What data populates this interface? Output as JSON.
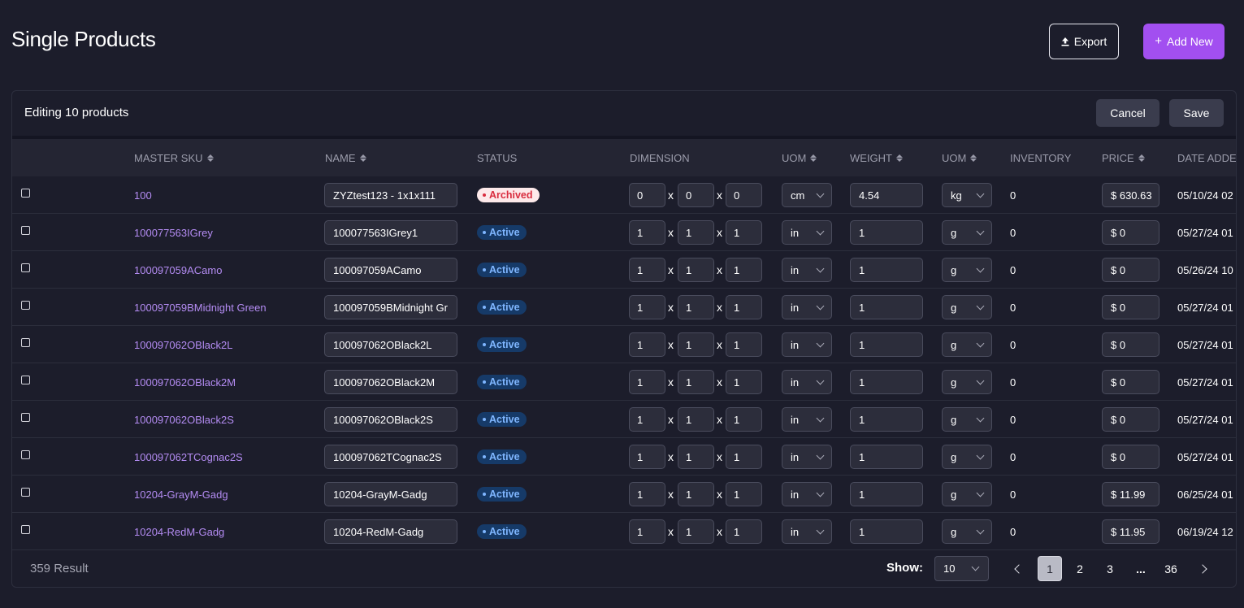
{
  "header": {
    "title": "Single Products",
    "export_label": "Export",
    "add_label": "Add New"
  },
  "edit_bar": {
    "text": "Editing 10 products",
    "cancel_label": "Cancel",
    "save_label": "Save"
  },
  "columns": {
    "master_sku": "MASTER SKU",
    "name": "NAME",
    "status": "STATUS",
    "dimension": "DIMENSION",
    "uom_dim": "UOM",
    "weight": "WEIGHT",
    "uom_weight": "UOM",
    "inventory": "INVENTORY",
    "price": "PRICE",
    "date_added": "DATE ADDED"
  },
  "dimension_separator": "x",
  "rows": [
    {
      "sku": "100",
      "name": "ZYZtest123 - 1x1x111",
      "status": "Archived",
      "d1": "0",
      "d2": "0",
      "d3": "0",
      "uom": "cm",
      "weight": "4.54",
      "wuom": "kg",
      "inventory": "0",
      "price": "$ 630.63",
      "date": "05/10/24 02"
    },
    {
      "sku": "100077563IGrey",
      "name": "100077563IGrey1",
      "status": "Active",
      "d1": "1",
      "d2": "1",
      "d3": "1",
      "uom": "in",
      "weight": "1",
      "wuom": "g",
      "inventory": "0",
      "price": "$ 0",
      "date": "05/27/24 01"
    },
    {
      "sku": "100097059ACamo",
      "name": "100097059ACamo",
      "status": "Active",
      "d1": "1",
      "d2": "1",
      "d3": "1",
      "uom": "in",
      "weight": "1",
      "wuom": "g",
      "inventory": "0",
      "price": "$ 0",
      "date": "05/26/24 10"
    },
    {
      "sku": "100097059BMidnight Green",
      "name": "100097059BMidnight Gr",
      "status": "Active",
      "d1": "1",
      "d2": "1",
      "d3": "1",
      "uom": "in",
      "weight": "1",
      "wuom": "g",
      "inventory": "0",
      "price": "$ 0",
      "date": "05/27/24 01"
    },
    {
      "sku": "100097062OBlack2L",
      "name": "100097062OBlack2L",
      "status": "Active",
      "d1": "1",
      "d2": "1",
      "d3": "1",
      "uom": "in",
      "weight": "1",
      "wuom": "g",
      "inventory": "0",
      "price": "$ 0",
      "date": "05/27/24 01"
    },
    {
      "sku": "100097062OBlack2M",
      "name": "100097062OBlack2M",
      "status": "Active",
      "d1": "1",
      "d2": "1",
      "d3": "1",
      "uom": "in",
      "weight": "1",
      "wuom": "g",
      "inventory": "0",
      "price": "$ 0",
      "date": "05/27/24 01"
    },
    {
      "sku": "100097062OBlack2S",
      "name": "100097062OBlack2S",
      "status": "Active",
      "d1": "1",
      "d2": "1",
      "d3": "1",
      "uom": "in",
      "weight": "1",
      "wuom": "g",
      "inventory": "0",
      "price": "$ 0",
      "date": "05/27/24 01"
    },
    {
      "sku": "100097062TCognac2S",
      "name": "100097062TCognac2S",
      "status": "Active",
      "d1": "1",
      "d2": "1",
      "d3": "1",
      "uom": "in",
      "weight": "1",
      "wuom": "g",
      "inventory": "0",
      "price": "$ 0",
      "date": "05/27/24 01"
    },
    {
      "sku": "10204-GrayM-Gadg",
      "name": "10204-GrayM-Gadg",
      "status": "Active",
      "d1": "1",
      "d2": "1",
      "d3": "1",
      "uom": "in",
      "weight": "1",
      "wuom": "g",
      "inventory": "0",
      "price": "$ 11.99",
      "date": "06/25/24 01"
    },
    {
      "sku": "10204-RedM-Gadg",
      "name": "10204-RedM-Gadg",
      "status": "Active",
      "d1": "1",
      "d2": "1",
      "d3": "1",
      "uom": "in",
      "weight": "1",
      "wuom": "g",
      "inventory": "0",
      "price": "$ 11.95",
      "date": "06/19/24 12"
    }
  ],
  "footer": {
    "result_text": "359 Result",
    "show_label": "Show:",
    "show_value": "10",
    "pages": [
      "1",
      "2",
      "3",
      "...",
      "36"
    ],
    "current_page": "1"
  },
  "colors": {
    "background": "#1c1d2b",
    "accent": "#a24ff0",
    "sku_link": "#b48cf3",
    "active_badge_bg": "#163a68",
    "active_badge_text": "#7fb6ff",
    "archived_badge_bg": "#fde9ea",
    "archived_badge_text": "#d92d3f"
  },
  "icons": {
    "export": "upload-icon",
    "add": "plus-icon",
    "select": "chevron-down-icon",
    "sort": "sort-icon",
    "prev": "chevron-left-icon",
    "next": "chevron-right-icon"
  }
}
